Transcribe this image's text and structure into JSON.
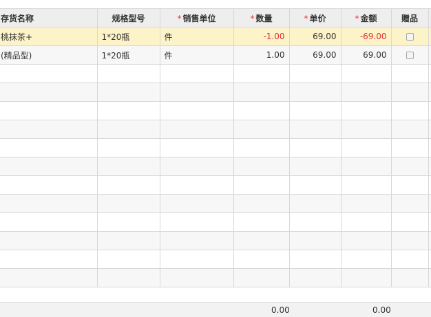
{
  "columns": {
    "name": "存货名称",
    "spec": "规格型号",
    "unit": "销售单位",
    "qty": "数量",
    "price": "单价",
    "amount": "金额",
    "gift": "赠品"
  },
  "required_mark": "*",
  "rows": [
    {
      "name": "桃抹茶+",
      "spec": "1*20瓶",
      "unit": "件",
      "qty": "-1.00",
      "price": "69.00",
      "amount": "-69.00",
      "negative": true,
      "selected": true,
      "gift_checked": false
    },
    {
      "name": "(精品型)",
      "spec": "1*20瓶",
      "unit": "件",
      "qty": "1.00",
      "price": "69.00",
      "amount": "69.00",
      "negative": false,
      "selected": false,
      "gift_checked": false
    }
  ],
  "empty_row_count": 12,
  "totals": {
    "qty": "0.00",
    "amount": "0.00"
  },
  "colors": {
    "negative": "#e03030",
    "selected_row": "#fdf3c8",
    "required": "#e33333"
  }
}
